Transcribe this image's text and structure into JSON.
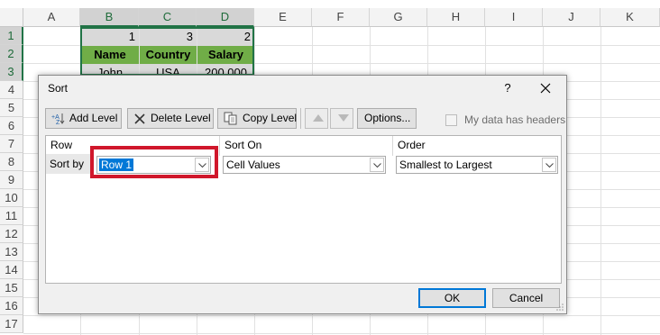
{
  "sheet": {
    "columns": [
      "A",
      "B",
      "C",
      "D",
      "E",
      "F",
      "G",
      "H",
      "I",
      "J",
      "K"
    ],
    "rows": [
      "1",
      "2",
      "3",
      "4",
      "5",
      "6",
      "7",
      "8",
      "9",
      "10",
      "11",
      "12",
      "13",
      "14",
      "15",
      "16",
      "17"
    ],
    "cells": {
      "b1": "1",
      "c1": "3",
      "d1": "2",
      "b2": "Name",
      "c2": "Country",
      "d2": "Salary",
      "b3": "John",
      "c3": "USA",
      "d3": "200,000"
    },
    "header_fill": "#70ad47",
    "selection_color": "#217346"
  },
  "dialog": {
    "title": "Sort",
    "help_glyph": "?",
    "close_glyph": "✕",
    "toolbar": {
      "add_level": "Add Level",
      "delete_level": "Delete Level",
      "copy_level": "Copy Level",
      "options": "Options...",
      "my_data_has_headers": "My data has headers"
    },
    "columns_header": {
      "row": "Row",
      "sort_on": "Sort On",
      "order": "Order"
    },
    "level": {
      "label": "Sort by",
      "row_value": "Row 1",
      "sort_on_value": "Cell Values",
      "order_value": "Smallest to Largest"
    },
    "ok": "OK",
    "cancel": "Cancel",
    "highlight_color": "#d0172b"
  }
}
